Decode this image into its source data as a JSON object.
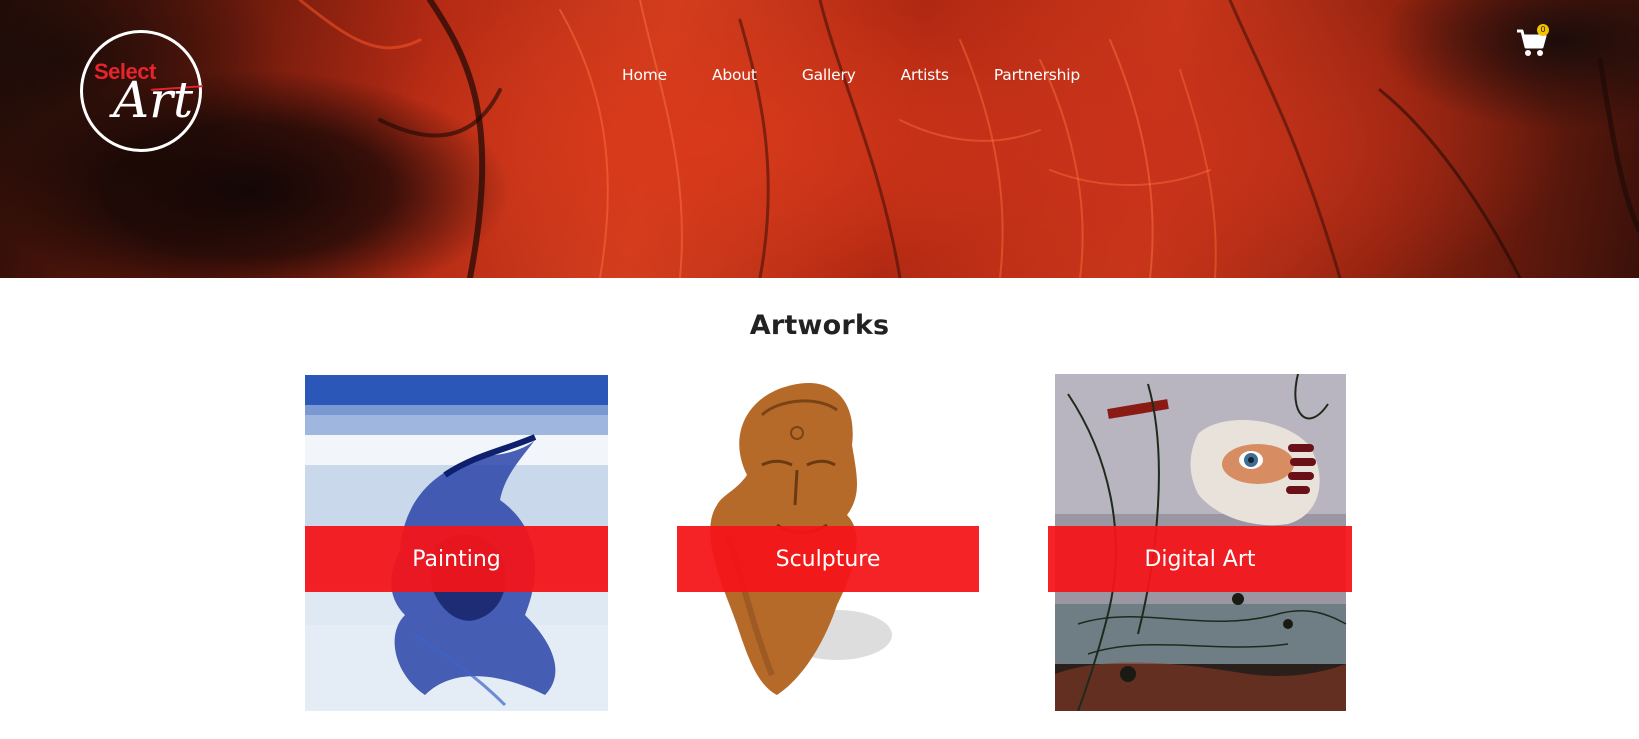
{
  "brand": {
    "logo_top_word": "Select",
    "logo_bottom_word": "Art",
    "accent_color": "#e8242b"
  },
  "nav": {
    "items": [
      {
        "label": "Home"
      },
      {
        "label": "About"
      },
      {
        "label": "Gallery"
      },
      {
        "label": "Artists"
      },
      {
        "label": "Partnership"
      }
    ]
  },
  "cart": {
    "icon": "shopping-cart-icon",
    "count": "0"
  },
  "section": {
    "title": "Artworks"
  },
  "categories": [
    {
      "label": "Painting",
      "label_color": "#f41418"
    },
    {
      "label": "Sculpture",
      "label_color": "#f41418"
    },
    {
      "label": "Digital Art",
      "label_color": "#f41418"
    }
  ]
}
